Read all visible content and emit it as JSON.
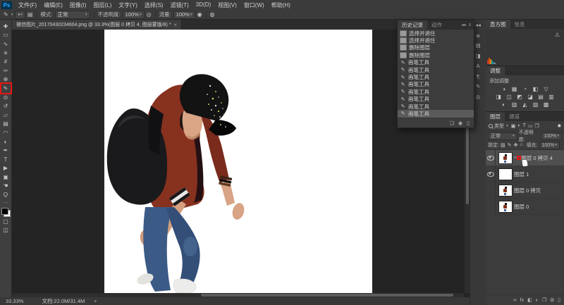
{
  "colors": {
    "annotation_red": "#e81515",
    "accent_blue": "#31a8ff",
    "canvas_white": "#ffffff"
  },
  "app": {
    "logo": "Ps"
  },
  "menubar": {
    "items": [
      "文件(F)",
      "编辑(E)",
      "图像(I)",
      "图层(L)",
      "文字(Y)",
      "选择(S)",
      "滤镜(T)",
      "3D(D)",
      "视图(V)",
      "窗口(W)",
      "帮助(H)"
    ]
  },
  "options_bar": {
    "tool_glyph": "✎",
    "preset_caret": "▾",
    "brush_preview_glyph": "•",
    "panel_toggle_glyph": "▤",
    "mode_label": "模式:",
    "mode_value": "正常",
    "opacity_label": "不透明度:",
    "opacity_value": "100%",
    "pressure_glyph": "◎",
    "flow_label": "流量:",
    "flow_value": "100%",
    "airbrush_glyph": "◉",
    "pressure_size_glyph": "◍"
  },
  "document_tab": {
    "title": "微信图片_20170430234604.png @ 33.3%(图层 0 拷贝 4, 图层蒙版/8) *",
    "close_glyph": "×"
  },
  "toolbar": {
    "tools": [
      {
        "name": "move-tool",
        "glyph": "✚"
      },
      {
        "name": "marquee-tool",
        "glyph": "▭"
      },
      {
        "name": "lasso-tool",
        "glyph": "∿"
      },
      {
        "name": "quick-selection-tool",
        "glyph": "✳"
      },
      {
        "name": "crop-tool",
        "glyph": "#"
      },
      {
        "name": "eyedropper-tool",
        "glyph": "✑"
      },
      {
        "name": "healing-brush-tool",
        "glyph": "⊕"
      },
      {
        "name": "brush-tool",
        "glyph": "✎",
        "selected": true
      },
      {
        "name": "clone-stamp-tool",
        "glyph": "⊙"
      },
      {
        "name": "history-brush-tool",
        "glyph": "↺"
      },
      {
        "name": "eraser-tool",
        "glyph": "▱"
      },
      {
        "name": "gradient-tool",
        "glyph": "▤"
      },
      {
        "name": "blur-tool",
        "glyph": "◠"
      },
      {
        "name": "dodge-tool",
        "glyph": "◐"
      },
      {
        "name": "pen-tool",
        "glyph": "✒"
      },
      {
        "name": "type-tool",
        "glyph": "T"
      },
      {
        "name": "path-selection-tool",
        "glyph": "▶"
      },
      {
        "name": "shape-tool",
        "glyph": "▣"
      },
      {
        "name": "hand-tool",
        "glyph": "☚"
      },
      {
        "name": "zoom-tool",
        "glyph": "Ϙ"
      }
    ],
    "more_glyph": "⋯",
    "quick_mask_glyph": "▢",
    "screen_mode_glyph": "◫"
  },
  "history_panel": {
    "tab": "历史记录",
    "tab2": "动作",
    "collapse_glyph": "◂◂",
    "menu_glyph": "≡",
    "items": [
      {
        "label": "选择并遮住",
        "icon": "thumb"
      },
      {
        "label": "选择并遮住",
        "icon": "thumb"
      },
      {
        "label": "删除图层",
        "icon": "thumb"
      },
      {
        "label": "删除图层",
        "icon": "thumb"
      },
      {
        "label": "画笔工具",
        "icon": "brush",
        "glyph": "✎"
      },
      {
        "label": "画笔工具",
        "icon": "brush",
        "glyph": "✎"
      },
      {
        "label": "画笔工具",
        "icon": "brush",
        "glyph": "✎"
      },
      {
        "label": "画笔工具",
        "icon": "brush",
        "glyph": "✎"
      },
      {
        "label": "画笔工具",
        "icon": "brush",
        "glyph": "✎"
      },
      {
        "label": "画笔工具",
        "icon": "brush",
        "glyph": "✎"
      },
      {
        "label": "画笔工具",
        "icon": "brush",
        "glyph": "✎"
      },
      {
        "label": "画笔工具",
        "icon": "brush",
        "glyph": "✎",
        "selected": true
      }
    ],
    "footer": [
      {
        "name": "new-doc-from-state-icon",
        "glyph": "❏"
      },
      {
        "name": "new-snapshot-icon",
        "glyph": "◉"
      },
      {
        "name": "delete-state-icon",
        "glyph": "▯"
      }
    ]
  },
  "icon_strip": {
    "icons": [
      {
        "name": "expand-panels-icon",
        "glyph": "◂◂"
      },
      {
        "name": "color-panel-icon",
        "glyph": "≣"
      },
      {
        "name": "swatches-panel-icon",
        "glyph": "▤"
      },
      {
        "name": "libraries-panel-icon",
        "glyph": "◨"
      },
      {
        "name": "character-panel-icon",
        "glyph": "A"
      },
      {
        "name": "paragraph-panel-icon",
        "glyph": "¶"
      },
      {
        "name": "brush-settings-panel-icon",
        "glyph": "✎"
      },
      {
        "name": "clone-source-panel-icon",
        "glyph": "◎"
      }
    ]
  },
  "right_panels": {
    "histogram": {
      "tab": "直方图",
      "tab2": "信息",
      "warning_glyph": "⚠"
    },
    "adjustments": {
      "tab": "调整",
      "add_label": "添加调整",
      "row1": [
        {
          "name": "brightness-contrast-icon",
          "glyph": "◑"
        },
        {
          "name": "levels-icon",
          "glyph": "▦"
        },
        {
          "name": "curves-icon",
          "glyph": "◔"
        },
        {
          "name": "exposure-icon",
          "glyph": "◧"
        },
        {
          "name": "vibrance-icon",
          "glyph": "▽"
        }
      ],
      "row2": [
        {
          "name": "hue-saturation-icon",
          "glyph": "◨"
        },
        {
          "name": "color-balance-icon",
          "glyph": "◫"
        },
        {
          "name": "black-white-icon",
          "glyph": "◩"
        },
        {
          "name": "photo-filter-icon",
          "glyph": "◪"
        },
        {
          "name": "channel-mixer-icon",
          "glyph": "▤"
        },
        {
          "name": "color-lookup-icon",
          "glyph": "▥"
        }
      ],
      "row3": [
        {
          "name": "invert-icon",
          "glyph": "◐"
        },
        {
          "name": "posterize-icon",
          "glyph": "▨"
        },
        {
          "name": "threshold-icon",
          "glyph": "◭"
        },
        {
          "name": "gradient-map-icon",
          "glyph": "▧"
        },
        {
          "name": "selective-color-icon",
          "glyph": "▩"
        }
      ]
    },
    "layers": {
      "tab": "图层",
      "tab2": "通道",
      "search_label": "类型",
      "search_caret": "▾",
      "filter_icons": [
        {
          "name": "filter-pixel-layers-icon",
          "glyph": "▣"
        },
        {
          "name": "filter-adjustment-layers-icon",
          "glyph": "◐"
        },
        {
          "name": "filter-type-layers-icon",
          "glyph": "T"
        },
        {
          "name": "filter-shape-layers-icon",
          "glyph": "▭"
        },
        {
          "name": "filter-smart-objects-icon",
          "glyph": "❐"
        }
      ],
      "filter_toggle_glyph": "◉",
      "blend_mode": "正常",
      "blend_caret": "▾",
      "opacity_label": "不透明度:",
      "opacity_value": "100%",
      "lock_label": "锁定:",
      "lock_icons": [
        {
          "name": "lock-transparency-icon",
          "glyph": "▨"
        },
        {
          "name": "lock-pixels-icon",
          "glyph": "✎"
        },
        {
          "name": "lock-position-icon",
          "glyph": "✥"
        },
        {
          "name": "lock-all-icon",
          "glyph": "⌂"
        }
      ],
      "fill_label": "填充:",
      "fill_value": "100%",
      "items": [
        {
          "name": "图层 0 拷贝 4",
          "visible": true,
          "selected": true,
          "kind": "person",
          "mask": true,
          "link_glyph": "∞"
        },
        {
          "name": "图层 1",
          "visible": true,
          "kind": "white"
        },
        {
          "name": "图层 0 拷贝",
          "visible": false,
          "kind": "person"
        },
        {
          "name": "图层 0",
          "visible": false,
          "kind": "person"
        }
      ],
      "footer": [
        {
          "name": "link-layers-icon",
          "glyph": "∞"
        },
        {
          "name": "layer-style-icon",
          "glyph": "fx"
        },
        {
          "name": "add-layer-mask-icon",
          "glyph": "◧"
        },
        {
          "name": "new-adjustment-layer-icon",
          "glyph": "◐"
        },
        {
          "name": "new-group-icon",
          "glyph": "❐"
        },
        {
          "name": "new-layer-icon",
          "glyph": "⊞"
        },
        {
          "name": "delete-layer-icon",
          "glyph": "▯"
        }
      ]
    }
  },
  "status_bar": {
    "zoom": "33.33%",
    "doc_info": "文档:22.0M/31.4M",
    "caret": "▸"
  }
}
